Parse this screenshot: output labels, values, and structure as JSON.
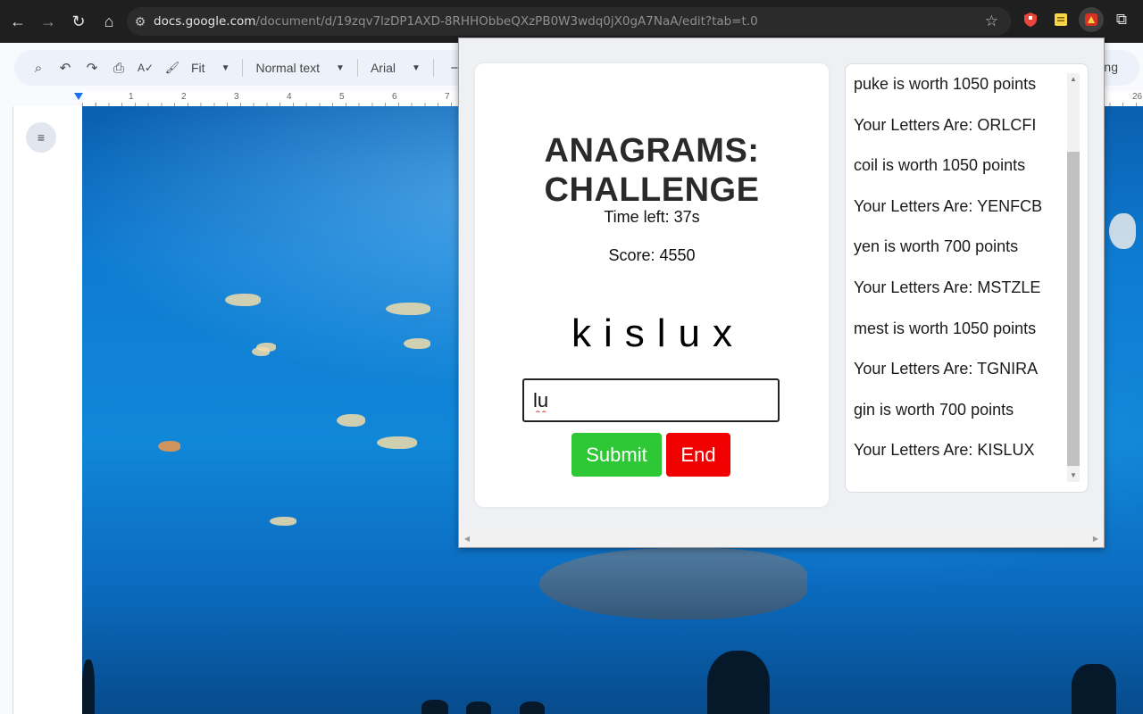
{
  "browser": {
    "url_host": "docs.google.com",
    "url_path": "/document/d/19zqv7lzDP1AXD-8RHHObbeQXzPB0W3wdq0jX0gA7NaA/edit?tab=t.0",
    "icons": {
      "back": "←",
      "forward": "→",
      "reload": "↻",
      "home": "⌂",
      "tune": "⚙",
      "star": "☆",
      "extensions": "⧉"
    }
  },
  "docs_toolbar": {
    "zoom": "Fit",
    "style": "Normal text",
    "font": "Arial",
    "font_size_minus": "−",
    "editing": "iting",
    "icons": {
      "search": "⌕",
      "undo": "↶",
      "redo": "↷",
      "print": "⎙",
      "spell": "A✓",
      "paint": "🖌"
    }
  },
  "ruler": {
    "numbers": [
      "1",
      "2",
      "3",
      "4",
      "5",
      "6",
      "7",
      "26"
    ]
  },
  "outline": {
    "icon": "≡"
  },
  "game": {
    "title": "ANAGRAMS:\nCHALLENGE",
    "time_left": "Time left: 37s",
    "score": "Score: 4550",
    "letters": "kislux",
    "input_value": "lu",
    "submit_label": "Submit",
    "end_label": "End"
  },
  "log": [
    "puke is worth 1050 points",
    "Your Letters Are: ORLCFI",
    "coil is worth 1050 points",
    "Your Letters Are: YENFCB",
    "yen is worth 700 points",
    "Your Letters Are: MSTZLE",
    "mest is worth 1050 points",
    "Your Letters Are: TGNIRA",
    "gin is worth 700 points",
    "Your Letters Are: KISLUX"
  ],
  "colors": {
    "submit": "#2ec735",
    "end": "#f00000",
    "browser_bar": "#1f1f1f"
  }
}
